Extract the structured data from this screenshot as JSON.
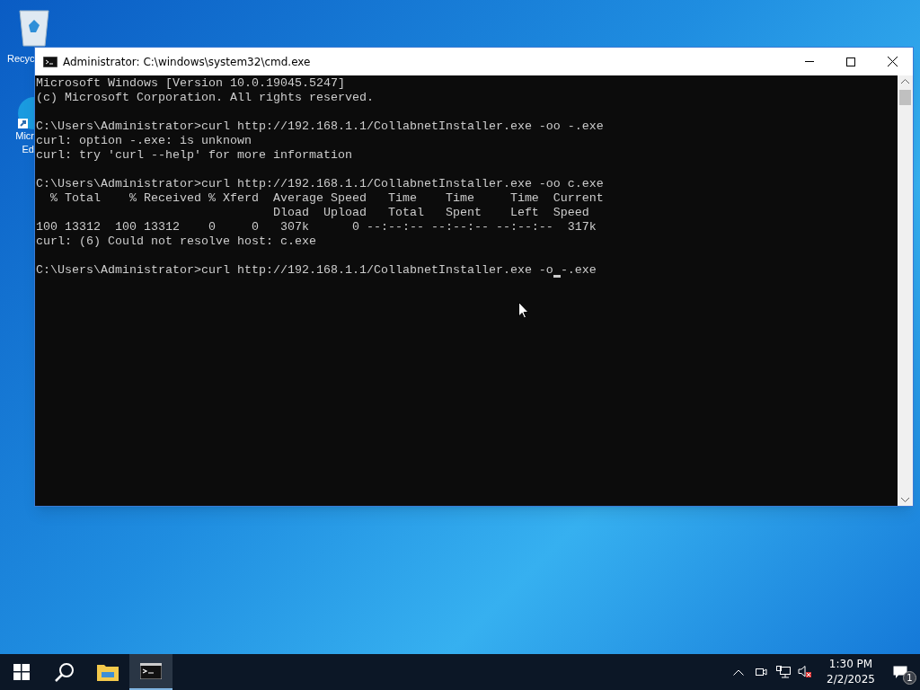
{
  "desktop_icons": [
    {
      "kind": "recycle",
      "label_lines": [
        "Recyc"
      ]
    },
    {
      "kind": "edge",
      "label_lines": [
        "Micr",
        "Ed"
      ]
    }
  ],
  "window": {
    "title": "Administrator: C:\\windows\\system32\\cmd.exe",
    "console_blocks": [
      [
        "Microsoft Windows [Version 10.0.19045.5247]",
        "(c) Microsoft Corporation. All rights reserved."
      ],
      [
        "C:\\Users\\Administrator>curl http://192.168.1.1/CollabnetInstaller.exe -oo -.exe",
        "curl: option -.exe: is unknown",
        "curl: try 'curl --help' for more information"
      ],
      [
        "C:\\Users\\Administrator>curl http://192.168.1.1/CollabnetInstaller.exe -oo c.exe",
        "  % Total    % Received % Xferd  Average Speed   Time    Time     Time  Current",
        "                                 Dload  Upload   Total   Spent    Left  Speed",
        "100 13312  100 13312    0     0   307k      0 --:--:-- --:--:-- --:--:--  317k",
        "curl: (6) Could not resolve host: c.exe"
      ]
    ],
    "input_line": {
      "before_cursor": "C:\\Users\\Administrator>curl http://192.168.1.1/CollabnetInstaller.exe -o",
      "after_cursor": "-.exe"
    }
  },
  "taskbar": {
    "apps": [
      {
        "kind": "start",
        "selected": false
      },
      {
        "kind": "search",
        "selected": false
      },
      {
        "kind": "explorer",
        "selected": false
      },
      {
        "kind": "cmd",
        "selected": true
      }
    ],
    "time": "1:30 PM",
    "date": "2/2/2025",
    "notification_count": "1"
  }
}
